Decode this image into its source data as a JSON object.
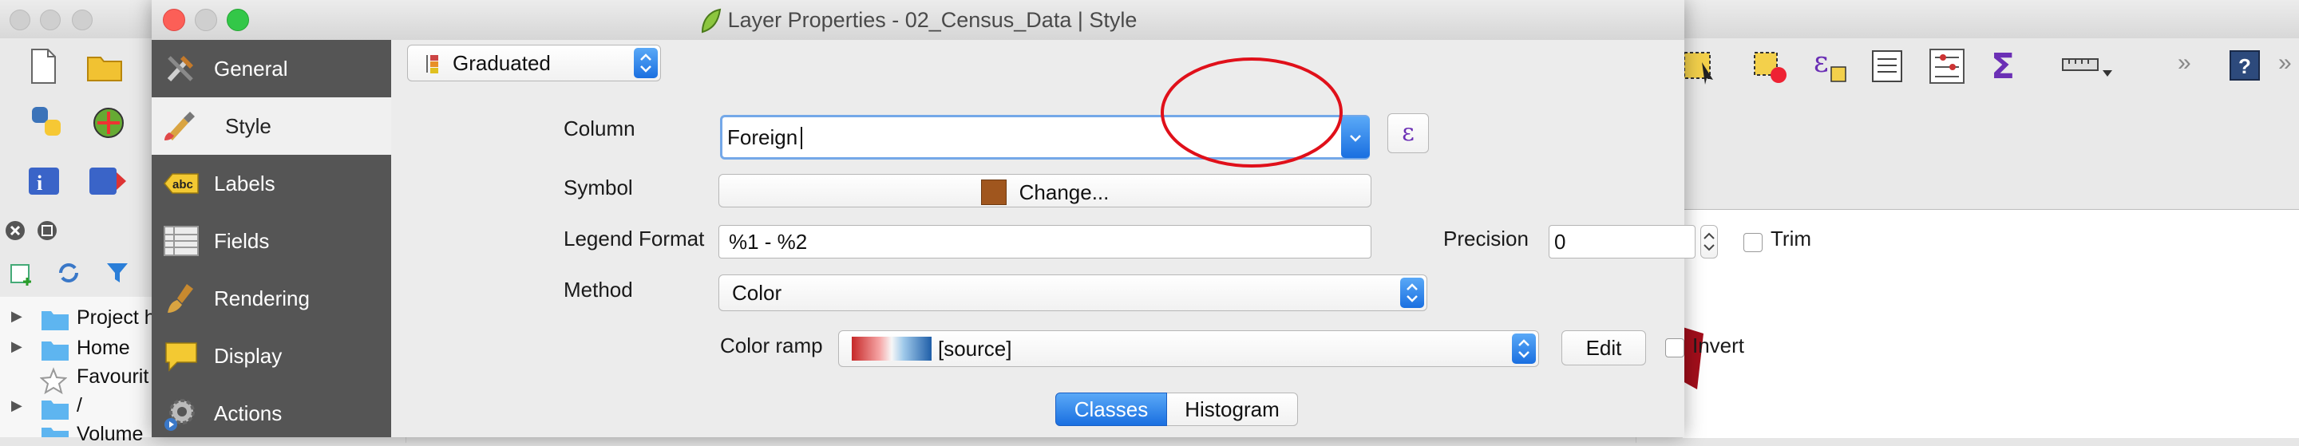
{
  "dialog": {
    "title": "Layer Properties - 02_Census_Data | Style"
  },
  "sidebar": {
    "items": [
      {
        "label": "General",
        "icon": "tools-icon"
      },
      {
        "label": "Style",
        "icon": "paintbrush-icon"
      },
      {
        "label": "Labels",
        "icon": "abc-label-icon"
      },
      {
        "label": "Fields",
        "icon": "table-icon"
      },
      {
        "label": "Rendering",
        "icon": "brush-icon"
      },
      {
        "label": "Display",
        "icon": "speech-bubble-icon"
      },
      {
        "label": "Actions",
        "icon": "gear-play-icon"
      }
    ],
    "selected": "Style"
  },
  "renderer": {
    "type_value": "Graduated"
  },
  "column": {
    "label": "Column",
    "value": "Foreign",
    "expression_button": "ε"
  },
  "symbol": {
    "label": "Symbol",
    "change_button": "Change...",
    "swatch_color": "#a0561e"
  },
  "legend": {
    "label": "Legend Format",
    "value": "%1 - %2",
    "precision_label": "Precision",
    "precision_value": "0",
    "trim_label": "Trim"
  },
  "method": {
    "label": "Method",
    "value": "Color"
  },
  "color_ramp": {
    "label": "Color ramp",
    "value": "[source]",
    "edit_button": "Edit",
    "invert_label": "Invert"
  },
  "tabs": {
    "classes": "Classes",
    "histogram": "Histogram",
    "active": "Classes"
  },
  "browser": {
    "items": [
      "Project h",
      "Home",
      "Favourit",
      "/",
      "Volume"
    ]
  },
  "colors": {
    "accent": "#1f7ae8",
    "sidebar_bg": "#555555",
    "annotation_circle": "#e0101a"
  }
}
